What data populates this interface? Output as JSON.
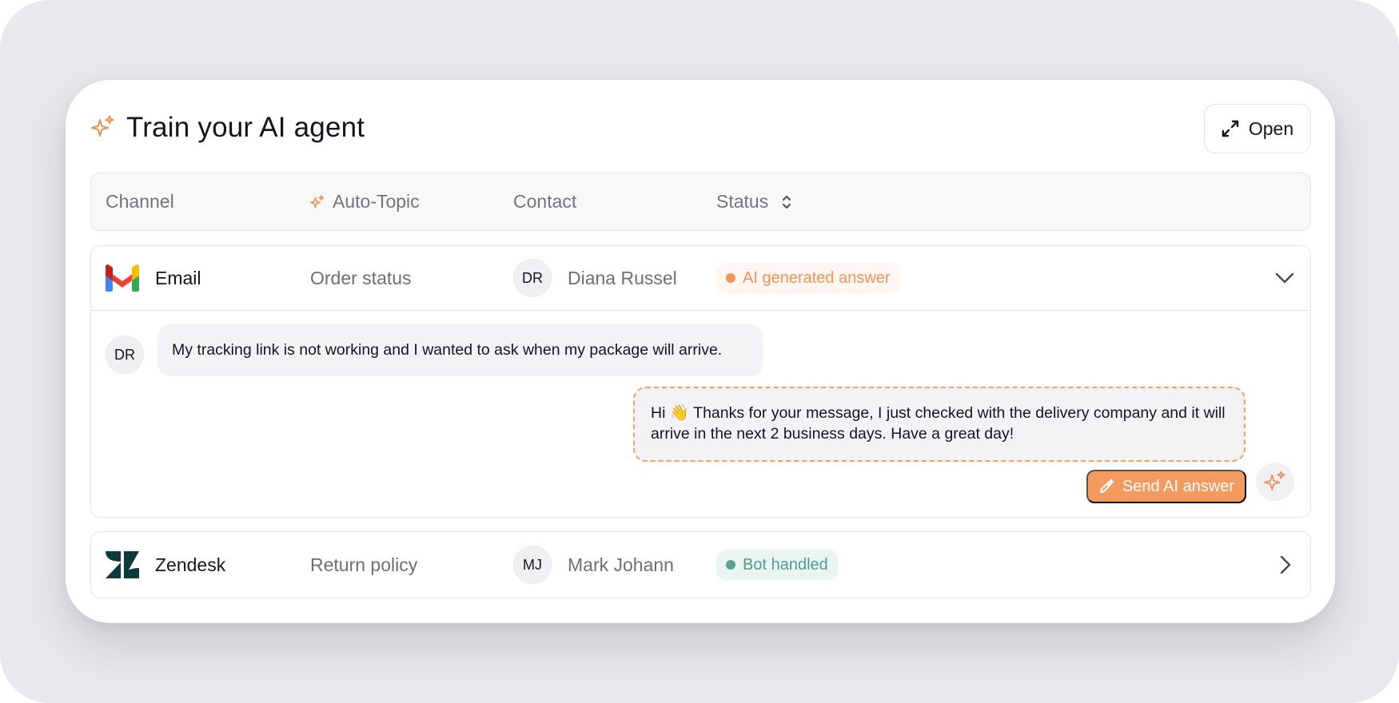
{
  "panel": {
    "title": "Train your AI agent",
    "title_icon": "sparkles-icon",
    "open_button": {
      "label": "Open",
      "icon": "expand-icon"
    }
  },
  "table": {
    "columns": [
      {
        "label": "Channel"
      },
      {
        "label": "Auto-Topic",
        "icon": "sparkles-icon"
      },
      {
        "label": "Contact"
      },
      {
        "label": "Status",
        "icon": "sort-icon"
      }
    ],
    "rows": [
      {
        "channel": "Email",
        "channel_icon": "gmail-icon",
        "topic": "Order status",
        "contact_initials": "DR",
        "contact_name": "Diana Russel",
        "status": "AI generated answer",
        "status_color": "#f2935a",
        "expanded": true,
        "conversation": {
          "incoming_initials": "DR",
          "incoming_message": "My tracking link is not working and I wanted to ask when my package will arrive.",
          "ai_answer": "Hi 👋 Thanks for your message, I just checked with the delivery company and it will arrive in the next 2 business days. Have a great day!",
          "send_button_label": "Send AI answer"
        }
      },
      {
        "channel": "Zendesk",
        "channel_icon": "zendesk-icon",
        "topic": "Return policy",
        "contact_initials": "MJ",
        "contact_name": "Mark Johann",
        "status": "Bot handled",
        "status_color": "#5aa394",
        "expanded": false
      }
    ]
  },
  "colors": {
    "accent": "#f59a5e",
    "page_background": "#e9e8ec",
    "text_primary": "#15141f",
    "text_secondary": "#6f6e76"
  }
}
